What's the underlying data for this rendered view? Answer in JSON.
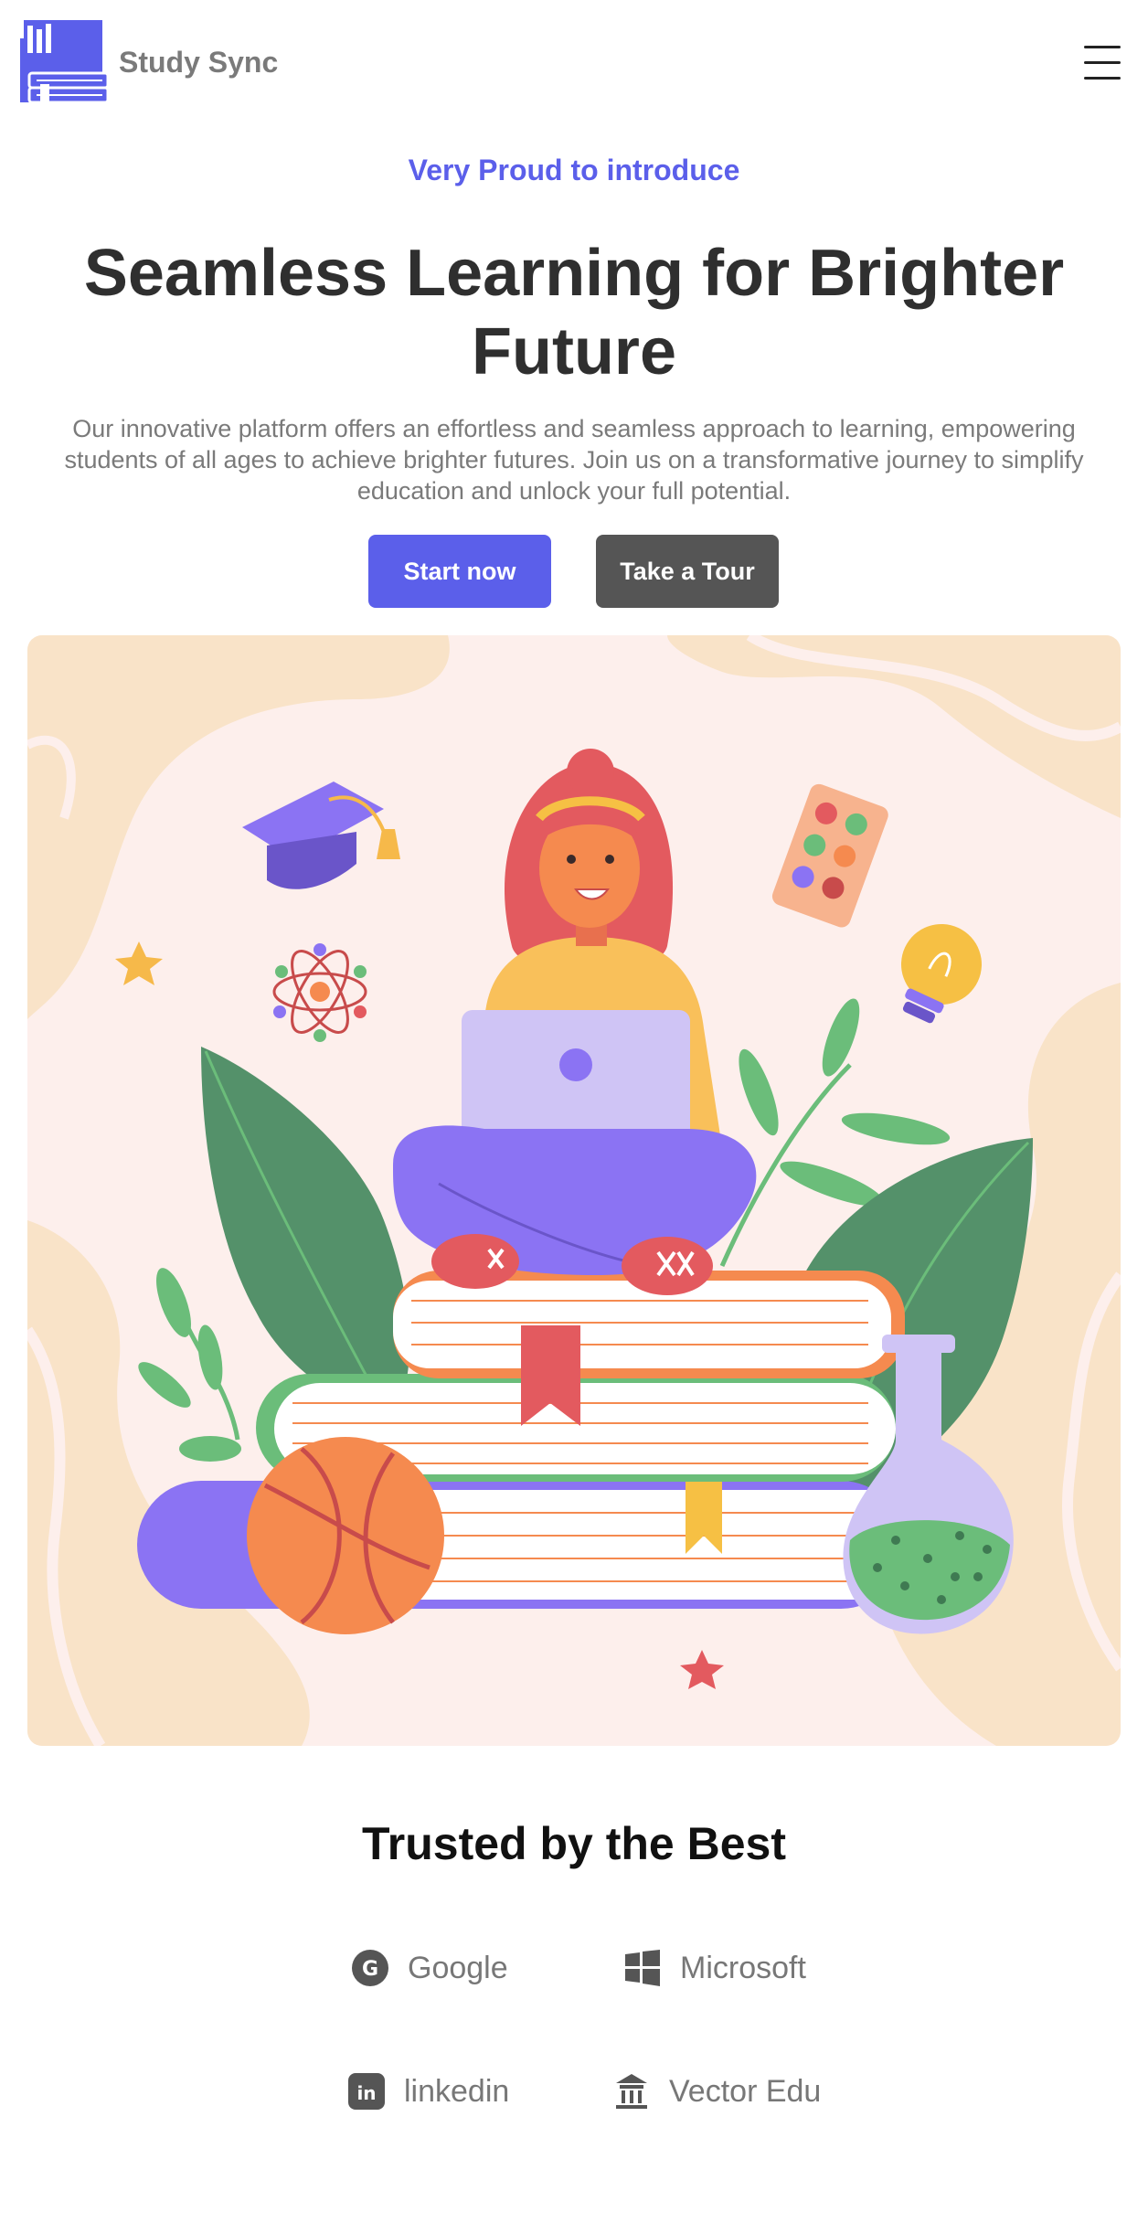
{
  "header": {
    "brand": "Study Sync",
    "logo_icon": "book-stack-logo",
    "menu_icon": "hamburger-menu-icon"
  },
  "hero": {
    "eyebrow": "Very Proud to introduce",
    "headline": "Seamless Learning for Brighter Future",
    "description": "Our innovative platform offers an effortless and seamless approach to learning, empowering students of all ages to achieve brighter futures. Join us on a transformative journey to simplify education and unlock your full potential.",
    "primary_button": "Start now",
    "secondary_button": "Take a Tour",
    "illustration": "student-with-laptop-on-books-illustration"
  },
  "trusted": {
    "title": "Trusted by the Best",
    "partners": [
      {
        "name": "Google",
        "icon": "google-icon"
      },
      {
        "name": "Microsoft",
        "icon": "microsoft-icon"
      },
      {
        "name": "linkedin",
        "icon": "linkedin-icon"
      },
      {
        "name": "Vector Edu",
        "icon": "building-icon"
      }
    ]
  },
  "colors": {
    "accent": "#5b5fea",
    "secondary_button": "#555555",
    "text_dark": "#2f2f2f",
    "text_muted": "#7a7a7a",
    "hero_bg": "#fdefec"
  }
}
